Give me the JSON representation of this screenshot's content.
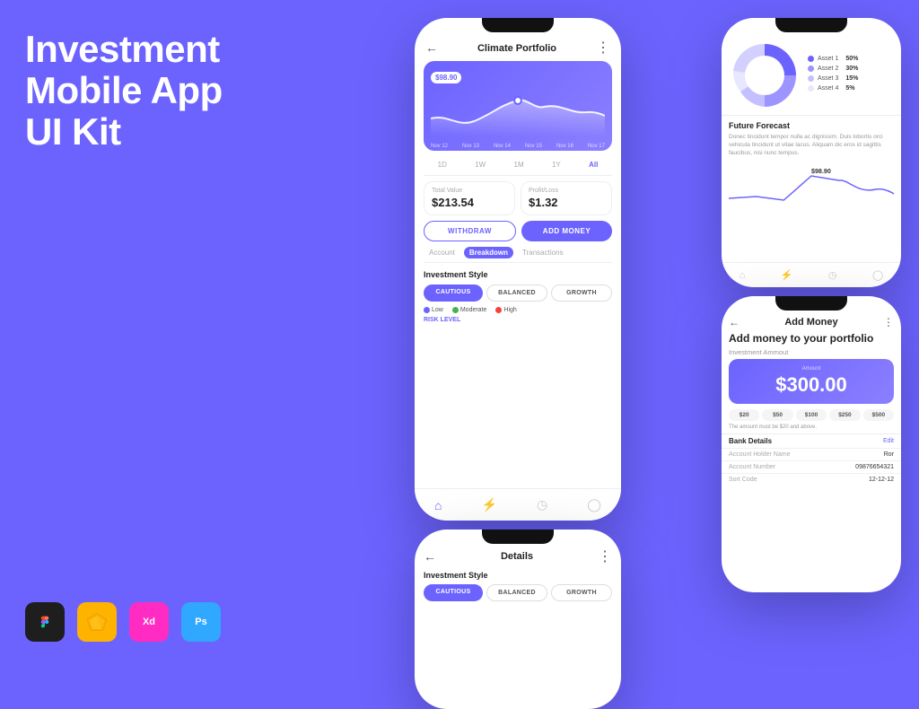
{
  "background": "#6C63FF",
  "title": {
    "line1": "Investment",
    "line2": "Mobile App UI Kit"
  },
  "tools": [
    {
      "name": "Figma",
      "symbol": "F",
      "bg": "#1E1E1E",
      "color": "#fff"
    },
    {
      "name": "Sketch",
      "symbol": "S",
      "bg": "#FDB300",
      "color": "#fff"
    },
    {
      "name": "XD",
      "symbol": "Xd",
      "bg": "#FF2BC2",
      "color": "#fff"
    },
    {
      "name": "Photoshop",
      "symbol": "Ps",
      "bg": "#31A8FF",
      "color": "#fff"
    }
  ],
  "mainPhone": {
    "title": "Climate Portfolio",
    "chartPrice": "$98.90",
    "chartDates": [
      "Nov 12",
      "Nov 13",
      "Nov 14",
      "Nov 15",
      "Nov 16",
      "Nov 17"
    ],
    "timeFilters": [
      "1D",
      "1W",
      "1M",
      "1Y",
      "All"
    ],
    "activeFilter": "All",
    "stats": {
      "totalValueLabel": "Total Value",
      "totalValue": "$213.54",
      "profitLossLabel": "Profit/Loss",
      "profitLoss": "$1.32"
    },
    "withdrawBtn": "WITHDRAW",
    "addMoneyBtn": "ADD MONEY",
    "tabs": [
      "Account",
      "Breakdown",
      "Transactions"
    ],
    "activeTab": "Breakdown",
    "investmentStyleTitle": "Investment Style",
    "styles": [
      "CAUTIOUS",
      "BALANCED",
      "GROWTH"
    ],
    "activeStyle": "CAUTIOUS",
    "riskIndicators": [
      {
        "label": "Low",
        "color": "#6C63FF"
      },
      {
        "label": "Moderate",
        "color": "#4CAF50"
      },
      {
        "label": "High",
        "color": "#F44336"
      }
    ],
    "riskLevelLabel": "RISK LEVEL"
  },
  "topRightPhone": {
    "donutData": [
      {
        "label": "Asset 1",
        "pct": "50%",
        "color": "#6C63FF"
      },
      {
        "label": "Asset 2",
        "pct": "30%",
        "color": "#9C94FF"
      },
      {
        "label": "Asset 3",
        "pct": "15%",
        "color": "#C4C0FF"
      },
      {
        "label": "Asset 4",
        "pct": "5%",
        "color": "#E8E7FF"
      }
    ],
    "forecastTitle": "Future Forecast",
    "forecastText": "Donec tincidunt tempor nulla ac dignissim. Duis lobortis orci vehicula tincidunt ut vitae lacus. Aliquam dic eros id sagittis faucibus, nisi nunc tempus.",
    "forecastPrice": "$98.90"
  },
  "bottomRightPhone": {
    "title": "Add Money",
    "subtitle": "Add money to your portfolio",
    "investmentAmountLabel": "Investment Ammout",
    "amountLabel": "Amount",
    "amount": "$300.00",
    "quickAmounts": [
      "$20",
      "$50",
      "$100",
      "$250",
      "$500"
    ],
    "amountNote": "The amount must be $20 and above.",
    "bankDetailsTitle": "Bank Details",
    "bankEditLabel": "Edit",
    "bankFields": [
      {
        "label": "Account Holder Name",
        "value": "Ror"
      },
      {
        "label": "Account Number",
        "value": "09876654321"
      },
      {
        "label": "Sort Code",
        "value": "12-12-12"
      }
    ]
  },
  "bottomCenterPhone": {
    "title": "Details",
    "investmentStyleTitle": "Investment Style",
    "styles": [
      "CAUTIOUS",
      "BALANCED",
      "GROWTH"
    ],
    "activeStyle": "CAUTIOUS"
  }
}
